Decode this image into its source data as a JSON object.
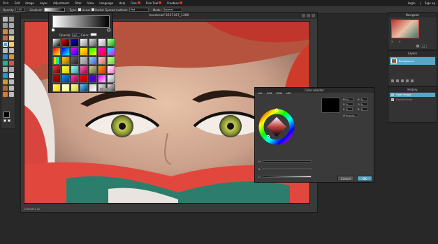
{
  "menu": {
    "brand": "Pixlr",
    "items": [
      "Edit",
      "Image",
      "Layer",
      "Adjustment",
      "Filter",
      "View",
      "Language",
      "Help",
      "Free",
      "Free Tool",
      "Freebies"
    ],
    "right": [
      "Login",
      "|",
      "Sign up"
    ]
  },
  "options": {
    "opacity_label": "Opacity:",
    "opacity_value": "100",
    "gradient_label": "Gradient:",
    "type_label": "Type:",
    "linear_label": "Linear",
    "radial_label": "Radial",
    "spread_label": "Spread method:",
    "spread_value": "Pad",
    "mode_label": "Mode:",
    "mode_value": "Normal"
  },
  "document": {
    "title": "hoodscarf-3257367_1280",
    "status": "1280x853 px"
  },
  "gradient_popup": {
    "opacity_label": "Opacity:",
    "opacity_value": "100",
    "color_label": "Color:"
  },
  "navigator": {
    "title": "Navigator",
    "x_label": "X:",
    "y_label": "Y:",
    "zoom": "97"
  },
  "layers": {
    "title": "Layers",
    "items": [
      {
        "name": "Background"
      }
    ]
  },
  "history": {
    "title": "History",
    "items": [
      {
        "label": "Open image",
        "selected": true
      },
      {
        "label": "Gradient tool",
        "selected": false
      }
    ]
  },
  "color_selector": {
    "title": "Color selector",
    "modes": [
      "HSL",
      "RGB",
      "WEB",
      "ABS"
    ],
    "fields_left": [
      "H:",
      "S:",
      "L:"
    ],
    "fields_right": [
      "R:",
      "G:",
      "B:"
    ],
    "values_left": [
      "0",
      "0",
      "0"
    ],
    "values_right": [
      "0",
      "0",
      "0"
    ],
    "hex_label": "#",
    "hex_value": "000000",
    "slider_labels": [
      "H:",
      "S:",
      "L:"
    ],
    "cancel": "Cancel",
    "ok": "OK"
  },
  "colors": {
    "accent": "#5ba6c5",
    "menubar": "#1f1f1f",
    "panel": "#333333"
  }
}
